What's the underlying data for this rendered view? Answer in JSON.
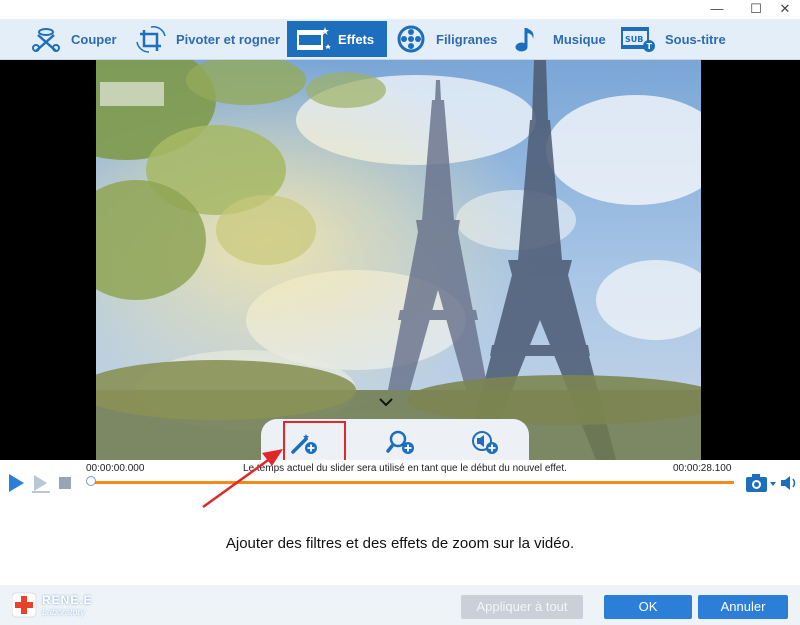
{
  "window": {
    "minimize": "—",
    "maximize": "☐",
    "close": "✕"
  },
  "toolbar": {
    "tabs": [
      {
        "label": "Couper",
        "icon": "cut-icon",
        "active": false
      },
      {
        "label": "Pivoter et rogner",
        "icon": "rotate-crop-icon",
        "active": false
      },
      {
        "label": "Effets",
        "icon": "effects-icon",
        "active": true
      },
      {
        "label": "Filigranes",
        "icon": "watermark-icon",
        "active": false
      },
      {
        "label": "Musique",
        "icon": "music-note-icon",
        "active": false
      },
      {
        "label": "Sous-titre",
        "icon": "subtitle-icon",
        "active": false
      }
    ]
  },
  "effects_panel": {
    "buttons": [
      {
        "name": "add-filter-button",
        "icon": "magic-wand-plus-icon",
        "highlighted": true
      },
      {
        "name": "add-zoom-button",
        "icon": "zoom-plus-icon",
        "highlighted": false
      },
      {
        "name": "add-volume-button",
        "icon": "volume-plus-icon",
        "highlighted": false
      }
    ]
  },
  "player": {
    "start_time": "00:00:00.000",
    "end_time": "00:00:28.100",
    "hint": "Le temps actuel du slider sera utilisé en tant que le début du nouvel effet.",
    "progress": 0.0,
    "progress_color": "#f08a1a"
  },
  "description": "Ajouter des filtres et des effets de zoom sur la vidéo.",
  "footer": {
    "logo_line1": "RENE.E",
    "logo_line2": "Laboratory",
    "apply_all": "Appliquer à tout",
    "ok": "OK",
    "cancel": "Annuler"
  },
  "colors": {
    "accent": "#1d6fbd",
    "highlight": "#e02828",
    "timeline": "#f08a1a"
  }
}
